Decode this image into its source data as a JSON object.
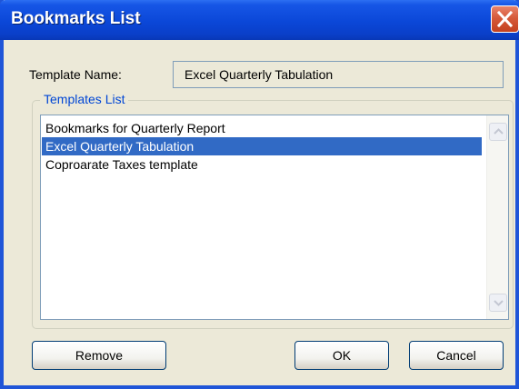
{
  "window": {
    "title": "Bookmarks List"
  },
  "template_name": {
    "label": "Template Name:",
    "value": "Excel Quarterly Tabulation"
  },
  "templates_list": {
    "group_label": "Templates List",
    "items": [
      {
        "label": "Bookmarks for Quarterly Report",
        "selected": false
      },
      {
        "label": "Excel Quarterly Tabulation",
        "selected": true
      },
      {
        "label": "Coproarate Taxes template",
        "selected": false
      }
    ]
  },
  "buttons": {
    "remove_label": "Remove",
    "ok_label": "OK",
    "cancel_label": "Cancel"
  },
  "icons": {
    "close": "close-icon",
    "scroll_up": "chevron-up-icon",
    "scroll_down": "chevron-down-icon"
  },
  "colors": {
    "titlebar": "#0b47d8",
    "selection": "#316ac5",
    "group_label": "#0046d5",
    "close_button": "#d65a3a"
  }
}
